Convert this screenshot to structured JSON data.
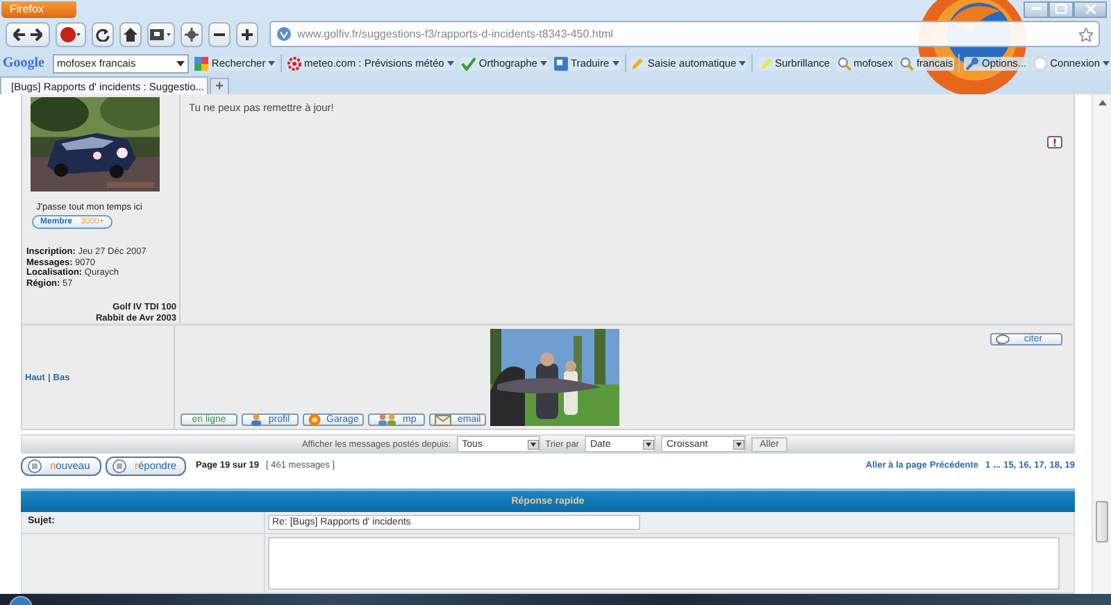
{
  "browser": {
    "menu_button": "Firefox",
    "url": "www.golfiv.fr/suggestions-f3/rapports-d-incidents-t8343-450.html"
  },
  "search_toolbar": {
    "logo": "Google",
    "query": "mofosex francais",
    "items": [
      {
        "label": "Rechercher",
        "kind": "grid",
        "dropdown": true
      },
      {
        "label": "meteo.com : Prévisions météo",
        "kind": "sun",
        "dropdown": true
      },
      {
        "label": "Orthographe",
        "kind": "check",
        "dropdown": true
      },
      {
        "label": "Traduire",
        "kind": "square",
        "dropdown": true
      },
      {
        "label": "Saisie automatique",
        "kind": "pencil",
        "dropdown": true
      },
      {
        "label": "Surbrillance",
        "kind": "marker",
        "dropdown": false
      },
      {
        "label": "mofosex",
        "kind": "magnifier",
        "dropdown": false
      },
      {
        "label": "francais",
        "kind": "magnifier",
        "dropdown": false
      },
      {
        "label": "Options...",
        "kind": "wrench",
        "dropdown": false
      },
      {
        "label": "Connexion",
        "kind": "user",
        "dropdown": true
      }
    ]
  },
  "tabs": [
    {
      "label": "[Bugs] Rapports d' incidents : Suggestio...",
      "selected": true
    }
  ],
  "new_tab": "+",
  "post": {
    "author": {
      "rank": "J'passe tout mon temps ici",
      "badge": {
        "label": "Membre",
        "count": "3000+"
      },
      "details": [
        {
          "label": "Inscription:",
          "value": "Jeu 27 Déc 2007"
        },
        {
          "label": "Messages:",
          "value": "9070"
        },
        {
          "label": "Localisation:",
          "value": "Quraych"
        },
        {
          "label": "Région:",
          "value": "57"
        }
      ],
      "car": [
        "Golf IV TDI 100",
        "Rabbit de Avr 2003"
      ]
    },
    "message": "Tu ne peux pas remettre à jour!",
    "nav_links": [
      "Haut",
      "Bas"
    ],
    "nav_separator": "|",
    "buttons": [
      {
        "label": "en ligne",
        "kind": "plain"
      },
      {
        "label": "profil",
        "kind": "person"
      },
      {
        "label": "Garage",
        "kind": "badge"
      },
      {
        "label": "mp",
        "kind": "people"
      },
      {
        "label": "email",
        "kind": "envelope"
      }
    ],
    "quote_button": "citer"
  },
  "sort_bar": {
    "show_label": "Afficher les messages postés depuis:",
    "show_value": "Tous",
    "sort_label": "Trier par",
    "sort_value": "Date",
    "order_value": "Croissant",
    "go_button": "Aller"
  },
  "actions": {
    "buttons": [
      "nouveau",
      "répondre"
    ],
    "page_info": "Page 19 sur 19",
    "count": "[ 461 messages ]",
    "goto_label": "Aller à la page",
    "previous": "Précédente",
    "pages": [
      "1",
      "...",
      "15,",
      "16,",
      "17,",
      "18,",
      "19"
    ]
  },
  "quick_reply": {
    "title": "Réponse rapide",
    "subject_label": "Sujet:",
    "subject_value": "Re: [Bugs] Rapports d' incidents"
  }
}
